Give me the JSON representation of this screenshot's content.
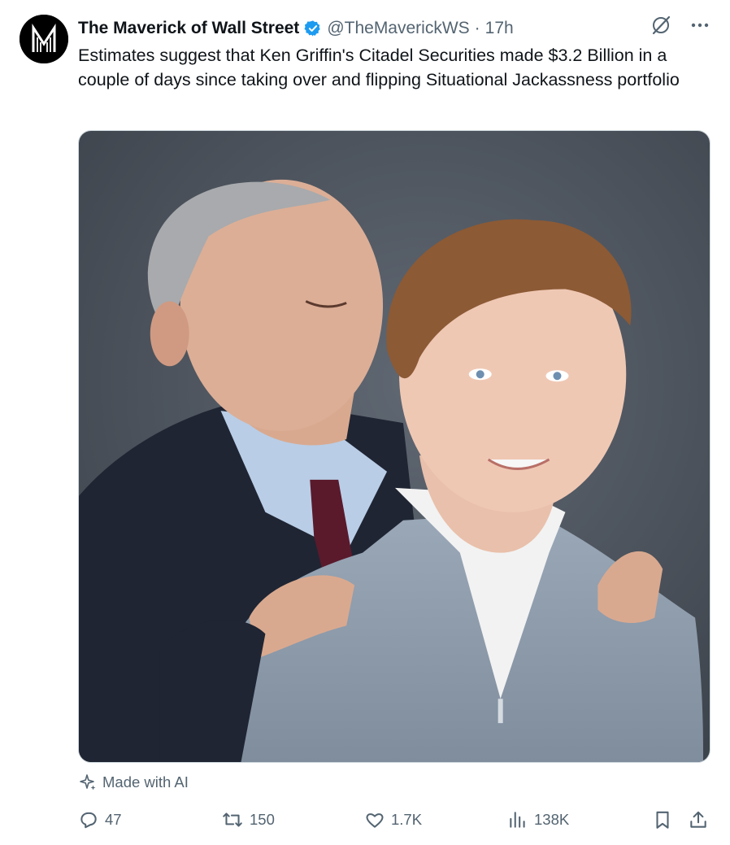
{
  "tweet": {
    "display_name": "The Maverick of Wall Street",
    "handle": "@TheMaverickWS",
    "separator": "·",
    "time": "17h",
    "text": "Estimates suggest that Ken Griffin's Citadel Securities made $3.2 Billion in a couple of days since taking over and flipping Situational Jackassness portfolio",
    "ai_label": "Made with AI"
  },
  "actions": {
    "replies": "47",
    "reposts": "150",
    "likes": "1.7K",
    "views": "138K"
  },
  "icons": {
    "verified": "verified-badge-icon",
    "grok": "grok-icon",
    "more": "more-icon",
    "reply": "reply-icon",
    "repost": "repost-icon",
    "like": "like-icon",
    "views": "views-icon",
    "bookmark": "bookmark-icon",
    "share": "share-icon",
    "sparkle": "sparkle-icon"
  },
  "colors": {
    "text": "#0f1419",
    "secondary": "#536471",
    "verified": "#1d9bf0",
    "media_background": "#4c545e"
  }
}
